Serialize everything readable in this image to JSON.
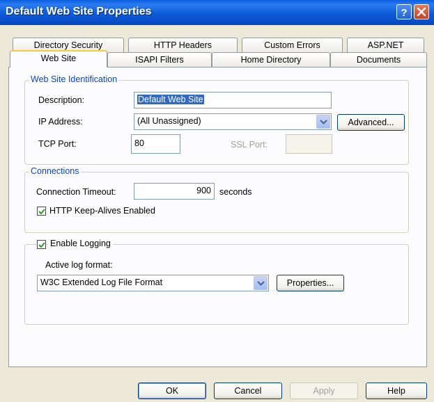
{
  "window": {
    "title": "Default Web Site Properties"
  },
  "tabs": {
    "row1": [
      "Directory Security",
      "HTTP Headers",
      "Custom Errors",
      "ASP.NET"
    ],
    "row2": [
      "Web Site",
      "ISAPI Filters",
      "Home Directory",
      "Documents"
    ],
    "active": "Web Site"
  },
  "identification": {
    "legend": "Web Site Identification",
    "description_label": "Description:",
    "description_value": "Default Web Site",
    "ip_label": "IP Address:",
    "ip_value": "(All Unassigned)",
    "advanced_label": "Advanced...",
    "tcp_label": "TCP Port:",
    "tcp_value": "80",
    "ssl_label": "SSL Port:",
    "ssl_value": ""
  },
  "connections": {
    "legend": "Connections",
    "timeout_label": "Connection Timeout:",
    "timeout_value": "900",
    "timeout_unit": "seconds",
    "keepalive_label": "HTTP Keep-Alives Enabled",
    "keepalive_checked": true
  },
  "logging": {
    "enable_label": "Enable Logging",
    "enable_checked": true,
    "format_label": "Active log format:",
    "format_value": "W3C Extended Log File Format",
    "properties_label": "Properties..."
  },
  "footer": {
    "ok": "OK",
    "cancel": "Cancel",
    "apply": "Apply",
    "help": "Help"
  },
  "colors": {
    "titlebar": "#0A5FE0",
    "tab_highlight": "#FFC83C",
    "legend_text": "#0046D5",
    "selection": "#316AC5"
  }
}
